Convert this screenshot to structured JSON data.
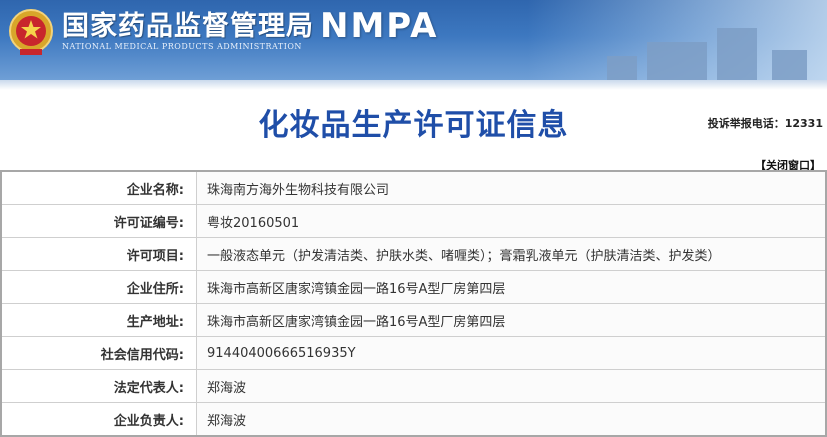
{
  "header": {
    "cn_title": "国家药品监督管理局",
    "abbr": "NMPA",
    "en_title": "NATIONAL MEDICAL PRODUCTS ADMINISTRATION",
    "emblem_icon": "national-emblem-icon"
  },
  "page": {
    "title": "化妆品生产许可证信息",
    "hotline": "投诉举报电话：12331",
    "close_label": "【关闭窗口】"
  },
  "colors": {
    "banner": "#3d78c0",
    "title": "#1f4ea8"
  },
  "fields": [
    {
      "label": "企业名称:",
      "value": "珠海南方海外生物科技有限公司"
    },
    {
      "label": "许可证编号:",
      "value": "粤妆20160501"
    },
    {
      "label": "许可项目:",
      "value": "一般液态单元（护发清洁类、护肤水类、啫喱类）；膏霜乳液单元（护肤清洁类、护发类）"
    },
    {
      "label": "企业住所:",
      "value": "珠海市高新区唐家湾镇金园一路16号A型厂房第四层"
    },
    {
      "label": "生产地址:",
      "value": "珠海市高新区唐家湾镇金园一路16号A型厂房第四层"
    },
    {
      "label": "社会信用代码:",
      "value": "91440400666516935Y"
    },
    {
      "label": "法定代表人:",
      "value": "郑海波"
    },
    {
      "label": "企业负责人:",
      "value": "郑海波"
    }
  ]
}
